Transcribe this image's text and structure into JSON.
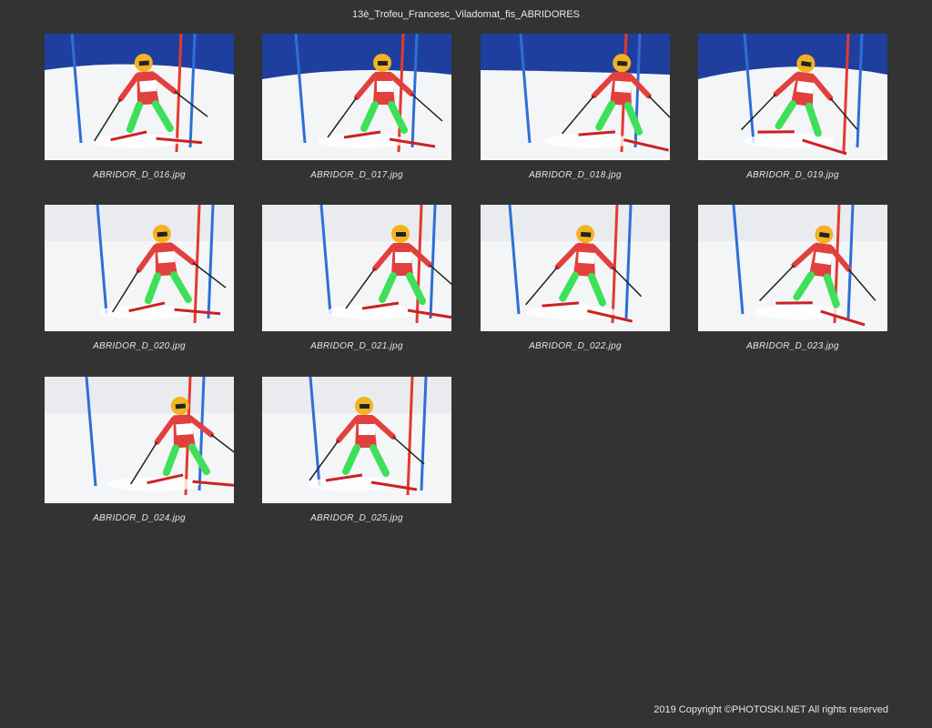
{
  "page": {
    "title": "13è_Trofeu_Francesc_Viladomat_fis_ABRIDORES",
    "copyright": "2019 Copyright ©PHOTOSKI.NET All rights reserved"
  },
  "photos": [
    {
      "file": "ABRIDOR_D_016.jpg",
      "sky": true
    },
    {
      "file": "ABRIDOR_D_017.jpg",
      "sky": true
    },
    {
      "file": "ABRIDOR_D_018.jpg",
      "sky": true
    },
    {
      "file": "ABRIDOR_D_019.jpg",
      "sky": true
    },
    {
      "file": "ABRIDOR_D_020.jpg",
      "sky": false
    },
    {
      "file": "ABRIDOR_D_021.jpg",
      "sky": false
    },
    {
      "file": "ABRIDOR_D_022.jpg",
      "sky": false
    },
    {
      "file": "ABRIDOR_D_023.jpg",
      "sky": false
    },
    {
      "file": "ABRIDOR_D_024.jpg",
      "sky": false
    },
    {
      "file": "ABRIDOR_D_025.jpg",
      "sky": false
    }
  ],
  "colors": {
    "background": "#333333",
    "sky": "#1f3f9e",
    "snow": "#f4f5f7",
    "suit": "#e2403c",
    "boots": "#3ee05a",
    "helmet": "#f3b320",
    "gate_red": "#e23a2f",
    "gate_blue": "#2f6fd6"
  }
}
